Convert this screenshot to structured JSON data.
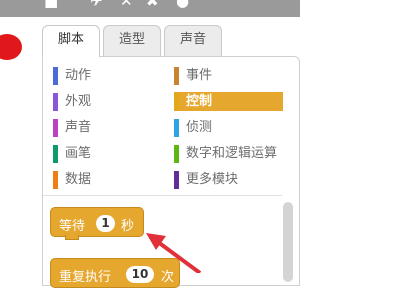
{
  "tabs": [
    {
      "label": "脚本",
      "active": true
    },
    {
      "label": "造型",
      "active": false
    },
    {
      "label": "声音",
      "active": false
    }
  ],
  "categories": [
    {
      "label": "动作",
      "color": "#4a6cd4",
      "selected": false
    },
    {
      "label": "外观",
      "color": "#8a55d7",
      "selected": false
    },
    {
      "label": "声音",
      "color": "#bb42c3",
      "selected": false
    },
    {
      "label": "画笔",
      "color": "#0e9a6c",
      "selected": false
    },
    {
      "label": "数据",
      "color": "#ee7d16",
      "selected": false
    },
    {
      "label": "事件",
      "color": "#c88330",
      "selected": false
    },
    {
      "label": "控制",
      "color": "#e1a91a",
      "selected": true
    },
    {
      "label": "侦测",
      "color": "#2ca5e2",
      "selected": false
    },
    {
      "label": "数字和逻辑运算",
      "color": "#5cb712",
      "selected": false
    },
    {
      "label": "更多模块",
      "color": "#632d99",
      "selected": false
    }
  ],
  "blocks": {
    "wait": {
      "before": "等待",
      "value": "1",
      "after": "秒"
    },
    "repeat": {
      "before": "重复执行",
      "value": "10",
      "after": "次"
    }
  },
  "colors": {
    "control": "#e6a72e",
    "arrow": "#e0313a",
    "stop": "#e0181b"
  },
  "icons": [
    "stop-icon",
    "flag-icon",
    "arrow-icon",
    "help-icon"
  ]
}
